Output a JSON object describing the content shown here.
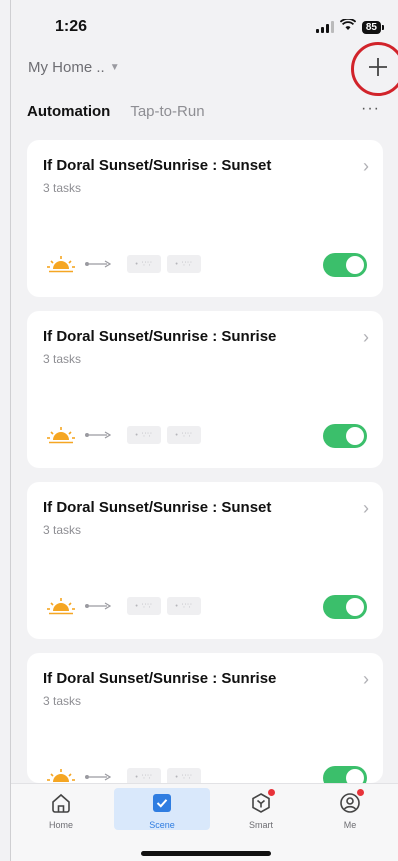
{
  "status": {
    "time": "1:26",
    "battery": "85"
  },
  "header": {
    "home_name": "My Home ..",
    "add_icon": "plus-icon"
  },
  "tabs": [
    {
      "label": "Automation",
      "active": true
    },
    {
      "label": "Tap-to-Run",
      "active": false
    }
  ],
  "more_label": "···",
  "cards": [
    {
      "title": "If Doral Sunset/Sunrise : Sunset",
      "subtitle": "3 tasks",
      "enabled": true
    },
    {
      "title": "If Doral Sunset/Sunrise : Sunrise",
      "subtitle": "3 tasks",
      "enabled": true
    },
    {
      "title": "If Doral Sunset/Sunrise : Sunset",
      "subtitle": "3 tasks",
      "enabled": true
    },
    {
      "title": "If Doral Sunset/Sunrise : Sunrise",
      "subtitle": "3 tasks",
      "enabled": true
    }
  ],
  "chip_text": "• ∵∵",
  "tabbar": {
    "home": "Home",
    "scene": "Scene",
    "smart": "Smart",
    "me": "Me"
  },
  "colors": {
    "accent": "#3bbf6b",
    "highlight_ring": "#d1232a",
    "sun": "#f5a623",
    "tab_active": "#2f7de1"
  }
}
